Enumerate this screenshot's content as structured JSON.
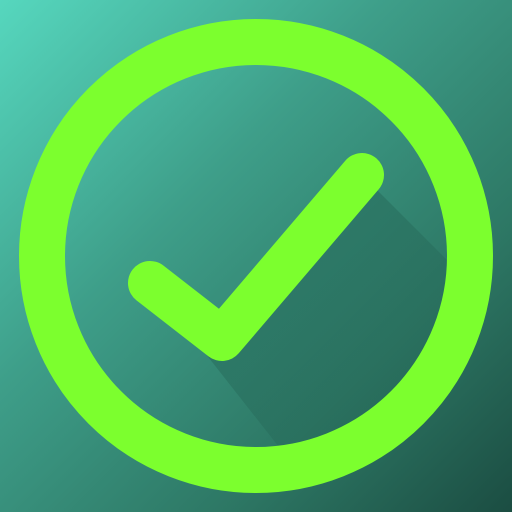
{
  "icon": {
    "name": "check-circle-icon",
    "colors": {
      "accent": "#7cff2e",
      "background_top_left": "#56d7be",
      "background_mid": "#3e9e89",
      "background_bottom_right": "#1b4d42",
      "shadow": "#1f5b4d"
    }
  }
}
